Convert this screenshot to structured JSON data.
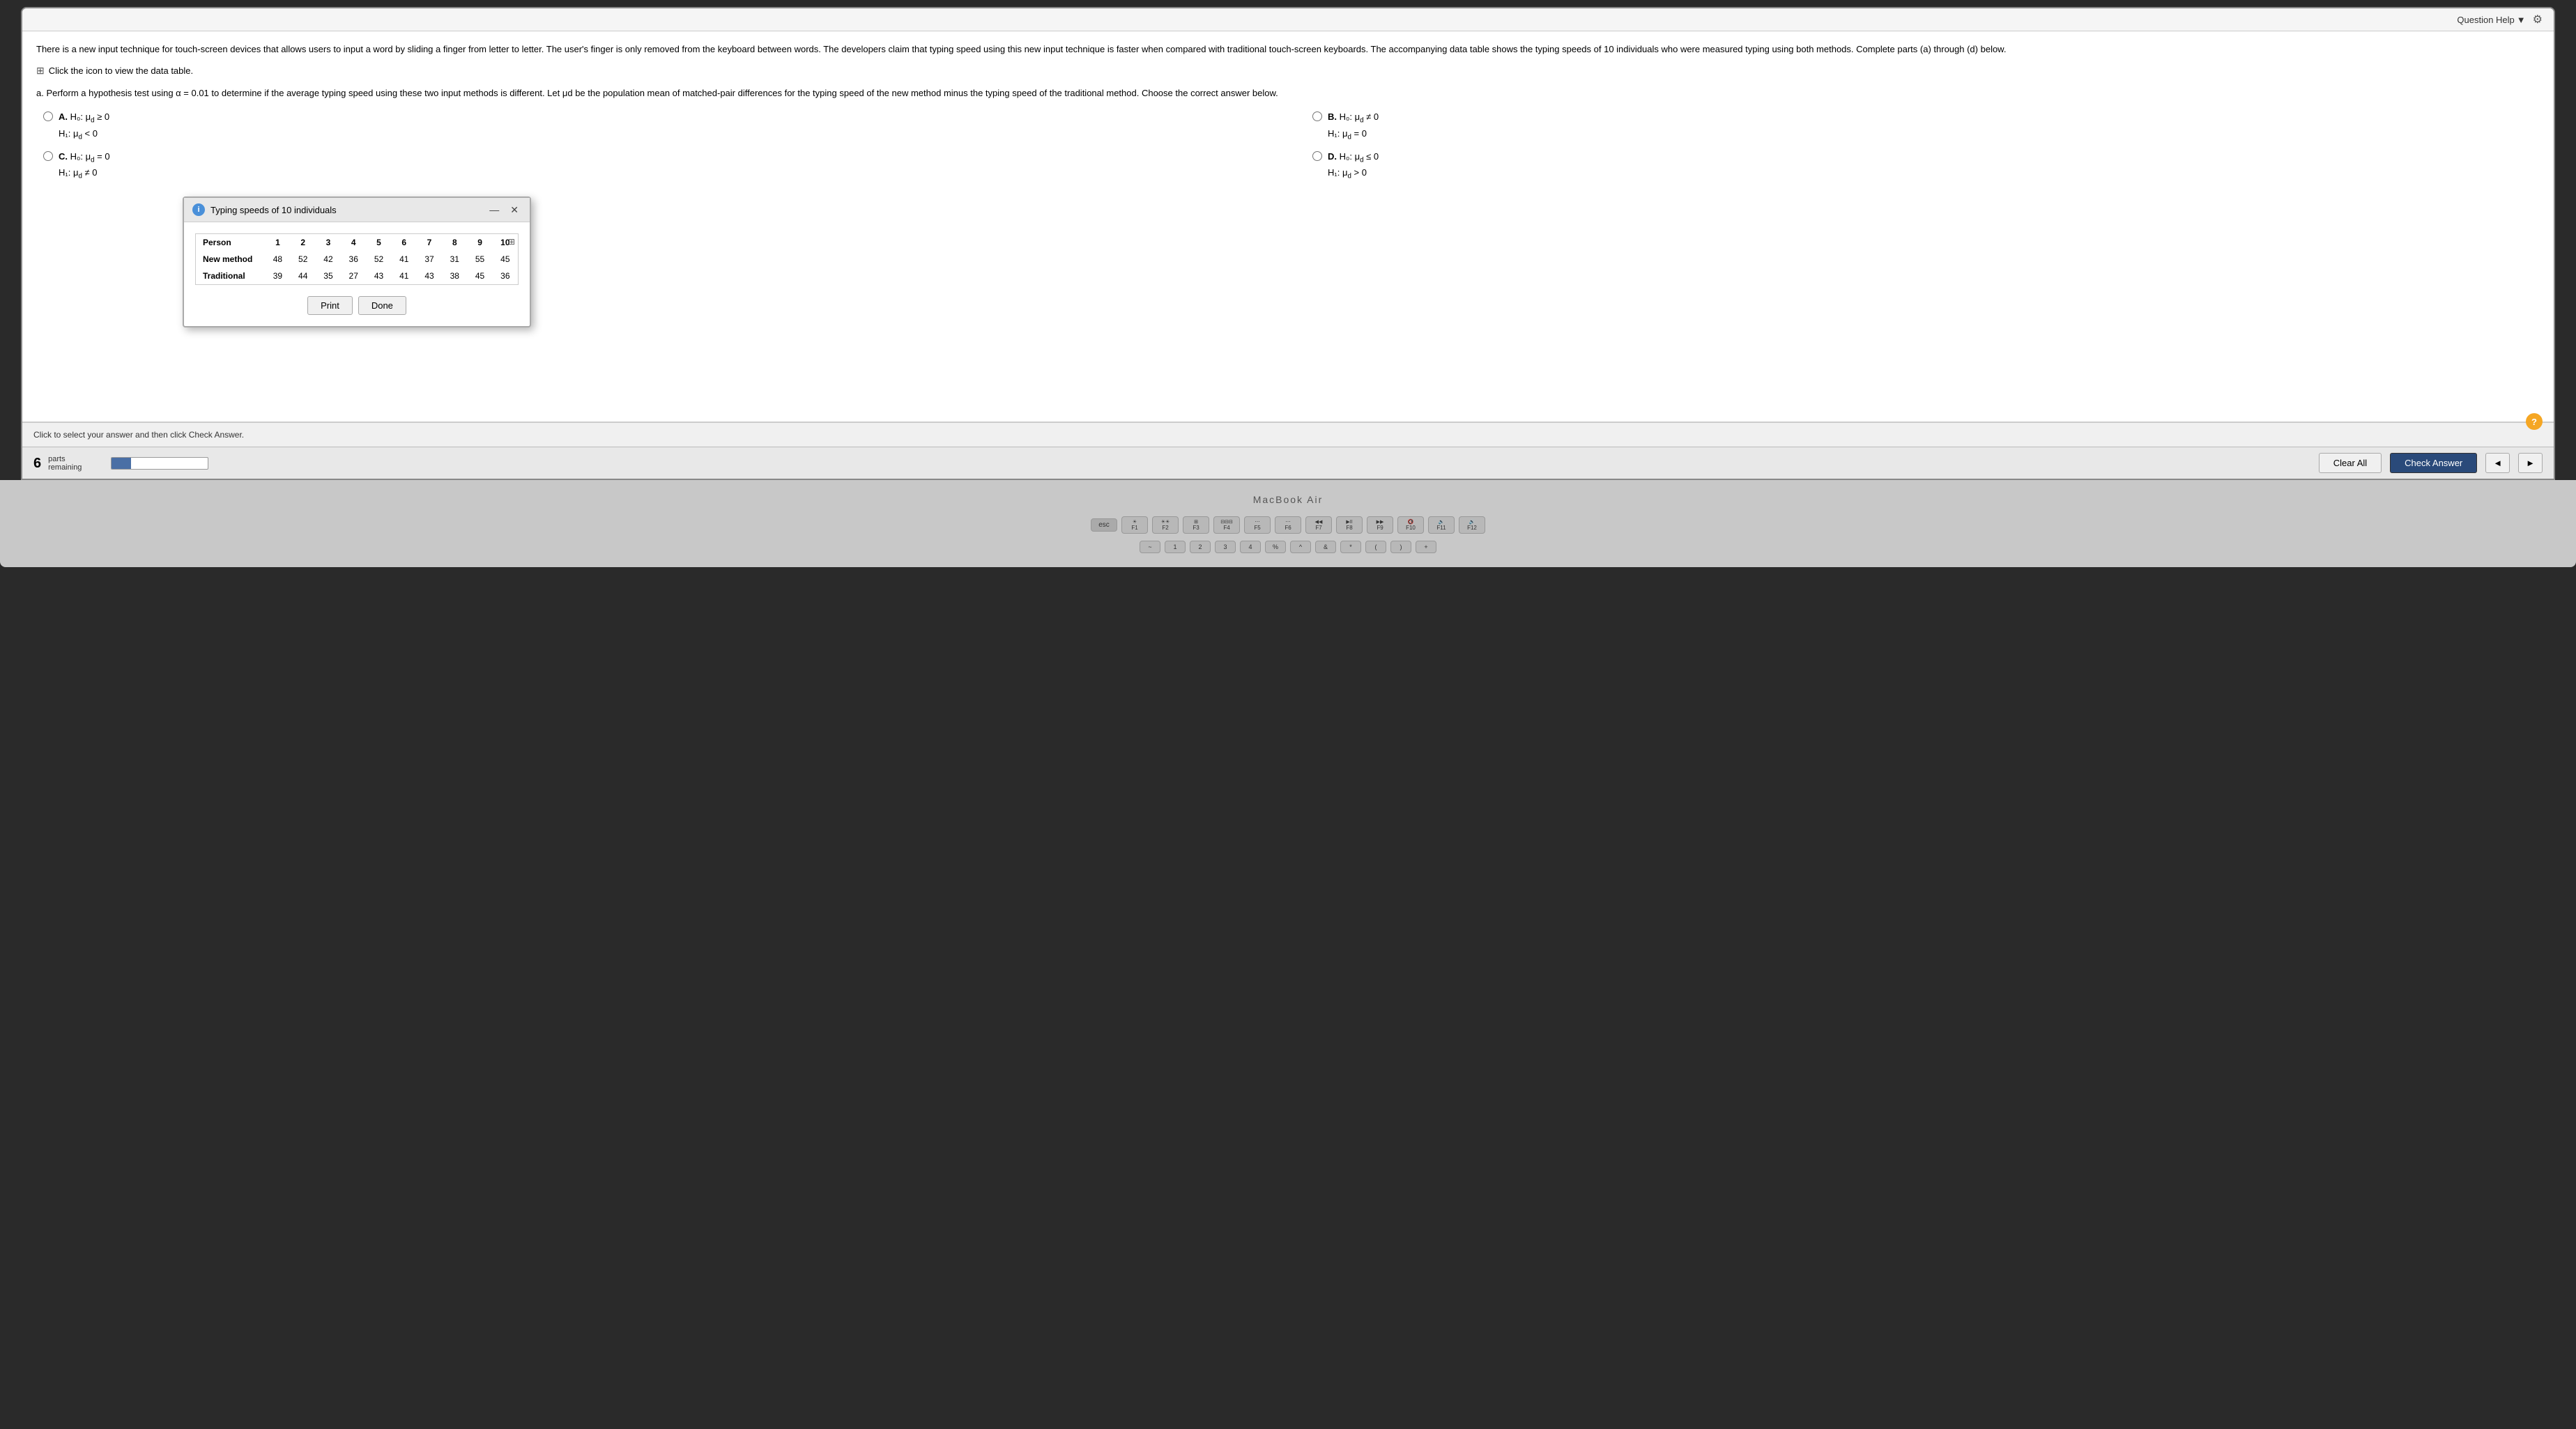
{
  "topBar": {
    "questionHelpLabel": "Question Help",
    "dropdownIcon": "▼",
    "gearIcon": "⚙"
  },
  "intro": {
    "text": "There is a new input technique for touch-screen devices that allows users to input a word by sliding a finger from letter to letter. The user's finger is only removed from the keyboard between words. The developers claim that typing speed using this new input technique is faster when compared with traditional touch-screen keyboards. The accompanying data table shows the typing speeds of 10 individuals who were measured typing using both methods. Complete parts (a) through (d) below.",
    "dataTableLink": "Click the icon to view the data table."
  },
  "partA": {
    "instruction": "a. Perform a hypothesis test using α = 0.01 to determine if the average typing speed using these two input methods is different. Let μd be the population mean of matched-pair differences for the typing speed of the new method minus the typing speed of the traditional method. Choose the correct answer below."
  },
  "options": [
    {
      "letter": "A",
      "h0": "H₀: μd ≥ 0",
      "h1": "H₁: μd < 0"
    },
    {
      "letter": "B",
      "h0": "H₀: μd ≠ 0",
      "h1": "H₁: μd = 0"
    },
    {
      "letter": "C",
      "h0": "H₀: μd = 0",
      "h1": "H₁: μd ≠ 0"
    },
    {
      "letter": "D",
      "h0": "H₀: μd ≤ 0",
      "h1": "H₁: μd > 0"
    }
  ],
  "popup": {
    "title": "Typing speeds of 10 individuals",
    "infoIcon": "i",
    "minimizeBtn": "—",
    "closeBtn": "✕",
    "expandIcon": "⊞",
    "table": {
      "headers": [
        "Person",
        "1",
        "2",
        "3",
        "4",
        "5",
        "6",
        "7",
        "8",
        "9",
        "10"
      ],
      "rows": [
        {
          "label": "New method",
          "values": [
            48,
            52,
            42,
            36,
            52,
            41,
            37,
            31,
            55,
            45
          ]
        },
        {
          "label": "Traditional",
          "values": [
            39,
            44,
            35,
            27,
            43,
            41,
            43,
            38,
            45,
            36
          ]
        }
      ]
    },
    "printBtn": "Print",
    "doneBtn": "Done"
  },
  "bottomSection": {
    "instructionText": "Click to select your answer and then click Check Answer.",
    "helpCircle": "?"
  },
  "footer": {
    "partsNumber": "6",
    "partsLabel": "parts",
    "remainingLabel": "remaining",
    "progressPercent": 20,
    "clearAllBtn": "Clear All",
    "checkAnswerBtn": "Check Answer",
    "prevBtn": "◄",
    "nextBtn": "►"
  },
  "keyboard": {
    "macbookLabel": "MacBook Air",
    "keys": {
      "esc": "esc",
      "f1": "F1",
      "f2": "F2",
      "f3": "F3",
      "f4": "F4",
      "f5": "F5",
      "f6": "F6",
      "f7": "F7",
      "f8": "F8",
      "f9": "F9",
      "f10": "F10",
      "f11": "F11",
      "f12": "F12"
    }
  }
}
